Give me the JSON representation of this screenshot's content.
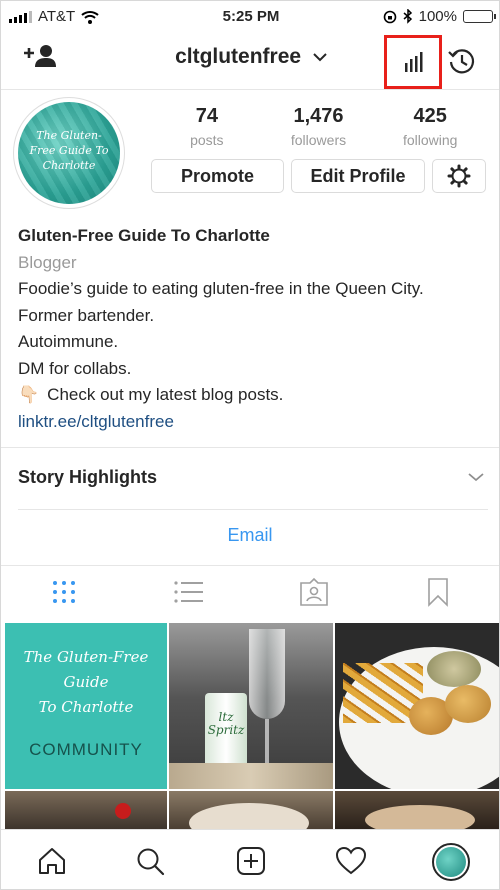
{
  "status_bar": {
    "carrier": "AT&T",
    "time": "5:25 PM",
    "battery": "100%",
    "battery_level": 1.0
  },
  "header": {
    "username": "cltglutenfree",
    "icons": [
      "add-user-icon",
      "chevron-down-icon",
      "insights-bar-chart-icon",
      "archive-history-icon"
    ],
    "highlight_color": "#e8201a"
  },
  "profile": {
    "avatar_text": "The Gluten-Free Guide To Charlotte",
    "stats": [
      {
        "value": "74",
        "label": "posts"
      },
      {
        "value": "1,476",
        "label": "followers"
      },
      {
        "value": "425",
        "label": "following"
      }
    ],
    "buttons": {
      "promote": "Promote",
      "edit_profile": "Edit Profile"
    }
  },
  "bio": {
    "name": "Gluten-Free Guide To Charlotte",
    "category": "Blogger",
    "lines": [
      "Foodie’s guide to eating gluten-free in the Queen City.",
      "Former bartender.",
      "Autoimmune.",
      "DM for collabs."
    ],
    "cta_emoji": "👇🏻",
    "cta": "Check out my latest blog posts.",
    "link": "linktr.ee/cltglutenfree",
    "link_color": "#1f4f82"
  },
  "story_highlights": "Story Highlights",
  "contact": {
    "email_label": "Email",
    "color": "#3897f0"
  },
  "tabs": {
    "icons": [
      "grid-icon",
      "list-icon",
      "tagged-icon",
      "saved-bookmark-icon"
    ],
    "active": "grid-icon",
    "active_color": "#3897f0"
  },
  "posts": [
    {
      "lines": [
        "The Gluten-Free",
        "Guide",
        "To Charlotte"
      ],
      "caption": "COMMUNITY"
    },
    {
      "can_text": "ltz Spritz"
    },
    {},
    {},
    {},
    {}
  ],
  "bottom_nav": {
    "icons": [
      "home-icon",
      "search-icon",
      "new-post-icon",
      "activity-heart-icon",
      "profile-avatar"
    ]
  }
}
